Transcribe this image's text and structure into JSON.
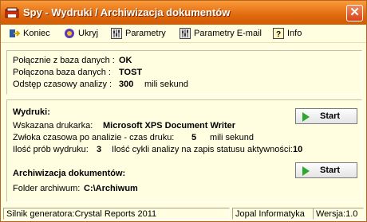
{
  "window": {
    "title": "Spy - Wydruki / Archiwizacja dokumentów",
    "close_glyph": "✕"
  },
  "menu": {
    "items": [
      {
        "label": "Koniec",
        "icon": "exit-icon"
      },
      {
        "label": "Ukryj",
        "icon": "hide-icon"
      },
      {
        "label": "Parametry",
        "icon": "parameters-icon"
      },
      {
        "label": "Parametry E-mail",
        "icon": "email-parameters-icon"
      },
      {
        "label": "Info",
        "icon": "info-icon"
      }
    ]
  },
  "connection": {
    "conn_label": "Połącznie z baza danych :",
    "conn_value": "OK",
    "db_label": "Połączona baza danych :",
    "db_value": "TOST",
    "interval_label": "Odstęp czasowy analizy :",
    "interval_value": "300",
    "interval_unit": "mili sekund"
  },
  "prints": {
    "heading": "Wydruki:",
    "printer_label": "Wskazana drukarka:",
    "printer_value": "Microsoft XPS Document Writer",
    "delay_label": "Zwłoka czasowa po analizie - czas druku:",
    "delay_value": "5",
    "delay_unit": "mili sekund",
    "tries_label": "Ilość prób wydruku:",
    "tries_value": "3",
    "cycles_label": "Ilość cykli analizy na zapis statusu aktywności:",
    "cycles_value": "10",
    "start_label": "Start"
  },
  "archive": {
    "heading": "Archiwizacja dokumentów:",
    "folder_label": "Folder archiwum:",
    "folder_value": "C:\\Archiwum",
    "start_label": "Start"
  },
  "status": {
    "engine": "Silnik generatora:Crystal Reports 2011",
    "vendor": "Jopal Informatyka",
    "version": "Wersja:1.0"
  },
  "colors": {
    "accent": "#e06a10",
    "background": "#fffee0",
    "play": "#2fa72f"
  }
}
